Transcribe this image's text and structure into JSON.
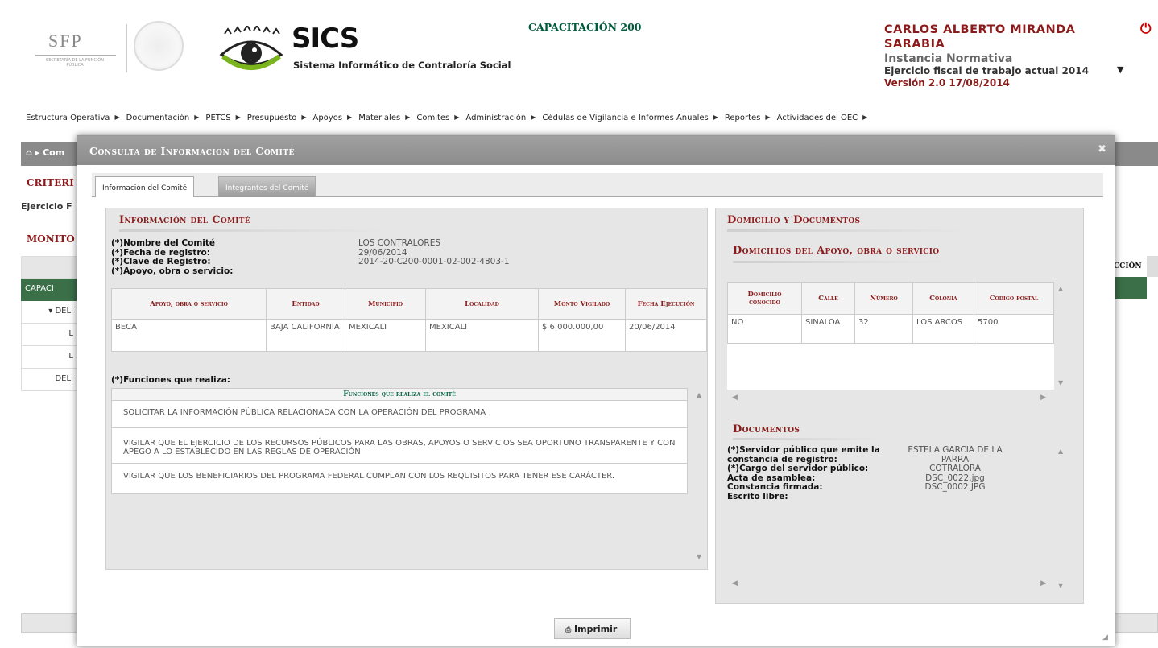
{
  "header": {
    "sfp_logo": "SFP",
    "sfp_sub": "SECRETARÍA DE LA FUNCIÓN PÚBLICA",
    "app_name": "SICS",
    "app_subtitle": "Sistema Informático de Contraloría Social",
    "program": "CAPACITACIÓN 200",
    "user_name": "CARLOS ALBERTO MIRANDA SARABIA",
    "role": "Instancia Normativa",
    "fiscal": "Ejercicio fiscal de trabajo actual 2014",
    "version": "Versión 2.0 17/08/2014",
    "power_icon": "power-icon",
    "accent": "#8b1a1a",
    "brand_green": "#005a3c"
  },
  "menu": [
    "Estructura Operativa",
    "Documentación",
    "PETCS",
    "Presupuesto",
    "Apoyos",
    "Materiales",
    "Comites",
    "Administración",
    "Cédulas de Vigilancia e Informes Anuales",
    "Reportes",
    "Actividades del OEC"
  ],
  "background": {
    "breadcrumb": "Com",
    "criterios": "CRITERI",
    "ejercicio": "Ejercicio F",
    "monitoreo": "MONITO",
    "col_right": "CCIÓN",
    "rows": [
      "CAPACI",
      "▾ DELI",
      "L",
      "L",
      "DELI"
    ]
  },
  "modal": {
    "title": "Consulta de Informacion del Comité",
    "close_icon": "close-icon",
    "tabs": [
      {
        "label": "Información del Comité",
        "active": true
      },
      {
        "label": "Integrantes del Comité",
        "active": false
      }
    ],
    "info": {
      "heading": "Información del Comité",
      "fields": [
        {
          "label": "(*)Nombre del Comité",
          "value": "LOS CONTRALORES"
        },
        {
          "label": "(*)Fecha de registro:",
          "value": "29/06/2014"
        },
        {
          "label": "(*)Clave de Registro:",
          "value": "2014-20-C200-0001-02-002-4803-1"
        },
        {
          "label": "(*)Apoyo, obra o servicio:",
          "value": ""
        }
      ],
      "apoyo_table": {
        "headers": [
          "Apoyo, obra o servicio",
          "Entidad",
          "Municipio",
          "Localidad",
          "Monto Vigilado",
          "Fecha Ejecución"
        ],
        "rows": [
          [
            "BECA",
            "BAJA CALIFORNIA",
            "MEXICALI",
            "MEXICALI",
            "$ 6.000.000,00",
            "20/06/2014"
          ]
        ]
      },
      "funciones_label": "(*)Funciones que realiza:",
      "funciones_header": "Funciones que realiza el comité",
      "funciones": [
        "SOLICITAR LA INFORMACIÓN PÚBLICA RELACIONADA CON LA OPERACIÓN DEL PROGRAMA",
        "VIGILAR QUE EL EJERCICIO DE LOS RECURSOS PÚBLICOS PARA LAS OBRAS, APOYOS O SERVICIOS SEA OPORTUNO TRANSPARENTE Y CON APEGO A LO ESTABLECIDO EN LAS REGLAS DE OPERACIÓN",
        "VIGILAR QUE LOS BENEFICIARIOS DEL PROGRAMA FEDERAL CUMPLAN CON LOS REQUISITOS PARA TENER ESE CARÁCTER."
      ]
    },
    "domicilio": {
      "heading": "Domicilio y Documentos",
      "sub_heading": "Domicilios del Apoyo, obra o servicio",
      "table": {
        "headers": [
          "Domicilio conocido",
          "Calle",
          "Número",
          "Colonia",
          "Codigo postal"
        ],
        "rows": [
          [
            "NO",
            "SINALOA",
            "32",
            "LOS ARCOS",
            "5700"
          ]
        ]
      },
      "docs_heading": "Documentos",
      "docs": [
        {
          "label": "(*)Servidor público que emite la constancia de registro:",
          "value": "ESTELA GARCIA DE LA PARRA"
        },
        {
          "label": "(*)Cargo del servidor público:",
          "value": "COTRALORA"
        },
        {
          "label": "Acta de asamblea:",
          "value": "DSC_0022.jpg"
        },
        {
          "label": "Constancia firmada:",
          "value": "DSC_0002.JPG"
        },
        {
          "label": "Escrito libre:",
          "value": ""
        }
      ]
    },
    "print_label": "Imprimir",
    "print_icon": "print-icon"
  }
}
